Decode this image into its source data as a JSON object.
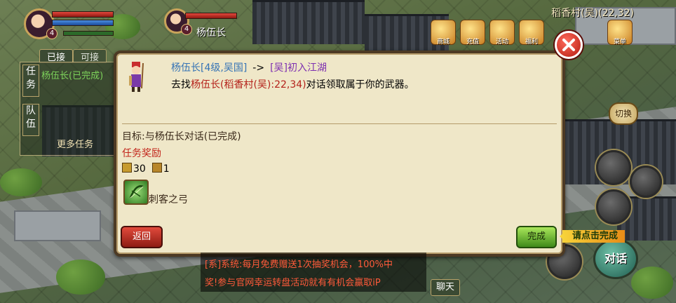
{
  "hud": {
    "player_level": "4",
    "npc_level": "4",
    "npc_name": "杨伍长",
    "location": "稻香村(吴)(22,32)"
  },
  "top_icons": [
    "商城",
    "充值",
    "活动",
    "福利",
    "菜单"
  ],
  "quest_panel": {
    "tab_accepted": "已接",
    "tab_available": "可接",
    "side_tab_quest": "任务",
    "side_tab_team": "队伍",
    "current_quest": "杨伍长(已完成)",
    "more_tasks": "更多任务"
  },
  "dialog": {
    "npc": "杨伍长[4级,吴国]",
    "arrow": "->",
    "quest_name": "[吴]初入江湖",
    "desc_prefix": "去找",
    "desc_target": "杨伍长(稻香村(吴):22,34)",
    "desc_suffix": "对话领取属于你的武器。",
    "goal": "目标:与杨伍长对话(已完成)",
    "reward_title": "任务奖励",
    "reward_exp": "30",
    "reward_coin": "1",
    "reward_item": "刺客之弓",
    "back_label": "返回",
    "done_label": "完成",
    "hint": "请点击完成"
  },
  "side_buttons": {
    "switch_label": "切换",
    "talk_label": "对话"
  },
  "chat": {
    "line1": "[系]系统:每月免费赠送1次抽奖机会，100%中",
    "line2": "奖!参与官网幸运转盘活动就有有机会赢取iP",
    "chat_label": "聊天"
  },
  "colors": {
    "npc_blue": "#3573b5",
    "quest_purple": "#7d2fb0",
    "highlight_red": "#b4211a",
    "dialog_bg": "#efe7c8"
  }
}
